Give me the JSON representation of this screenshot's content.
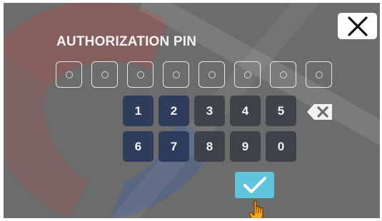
{
  "dialog": {
    "title": "AUTHORIZATION PIN"
  },
  "pin": {
    "length": 8,
    "filled": 0
  },
  "keypad": {
    "row1": [
      "1",
      "2",
      "3",
      "4",
      "5"
    ],
    "row2": [
      "6",
      "7",
      "8",
      "9",
      "0"
    ]
  },
  "icons": {
    "close": "close-x-icon",
    "backspace": "backspace-icon",
    "confirm": "checkmark-icon",
    "cursor": "hand-pointer-icon"
  },
  "colors": {
    "panel": "#6c6c6c",
    "confirm_button": "#5fc4dc",
    "key_dark": "#243458",
    "key_mid": "#3a3c44"
  }
}
